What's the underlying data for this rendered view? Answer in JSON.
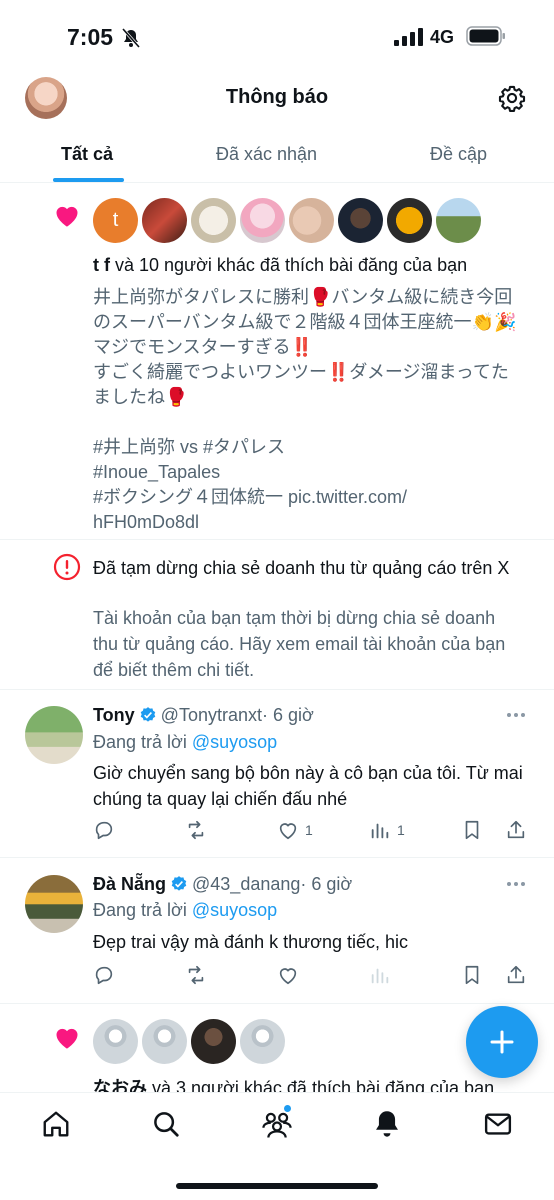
{
  "status": {
    "time": "7:05",
    "network": "4G"
  },
  "header": {
    "title": "Thông báo"
  },
  "tabs": [
    {
      "label": "Tất cả",
      "active": true
    },
    {
      "label": "Đã xác nhận",
      "active": false
    },
    {
      "label": "Đề cập",
      "active": false
    }
  ],
  "like_notification_1": {
    "avatar_letter": "t",
    "who": "t f",
    "rest": " và 10 người khác đã thích bài đăng của bạn",
    "quote": "井上尚弥がタパレスに勝利🥊バンタム級に続き今回\nのスーパーバンタム級で２階級４団体王座統一👏🎉\nマジでモンスターすぎる‼️\nすごく綺麗でつよいワンツー‼️ダメージ溜まってた\nましたね🥊\n\n#井上尚弥 vs #タパレス\n#Inoue_Tapales\n#ボクシング４団体統一 pic.twitter.com/\nhFH0mDo8dl"
  },
  "alert": {
    "title": "Đã tạm dừng chia sẻ doanh thu từ quảng cáo trên X",
    "body": "Tài khoản của bạn tạm thời bị dừng chia sẻ doanh thu từ quảng cáo. Hãy xem email tài khoản của bạn để biết thêm chi tiết."
  },
  "replies": [
    {
      "name": "Tony",
      "handle": "@Tonytranxt",
      "time": "· 6 giờ",
      "replying_prefix": "Đang trả lời ",
      "replying_to": "@suyosop",
      "text": "Giờ chuyển sang bộ bôn này à cô bạn của tôi. Từ mai chúng ta quay lại chiến đấu nhé",
      "likes": "1",
      "views": "1"
    },
    {
      "name": "Đà Nẵng",
      "handle": "@43_danang",
      "time": "· 6 giờ",
      "replying_prefix": "Đang trả lời ",
      "replying_to": "@suyosop",
      "text": "Đẹp trai vậy mà đánh k thương tiếc, hic",
      "likes": "",
      "views": ""
    }
  ],
  "like_notification_2": {
    "who": "なおみ",
    "rest": " và 3 người khác đã thích bài đăng của bạn"
  },
  "colors": {
    "accent": "#1d9bf0",
    "heart": "#f91880",
    "alert": "#f4212e",
    "secondary_text": "#536471"
  },
  "icons": [
    "home-icon",
    "search-icon",
    "communities-icon",
    "notifications-bell-icon",
    "messages-icon",
    "compose-plus-icon",
    "gear-icon"
  ]
}
